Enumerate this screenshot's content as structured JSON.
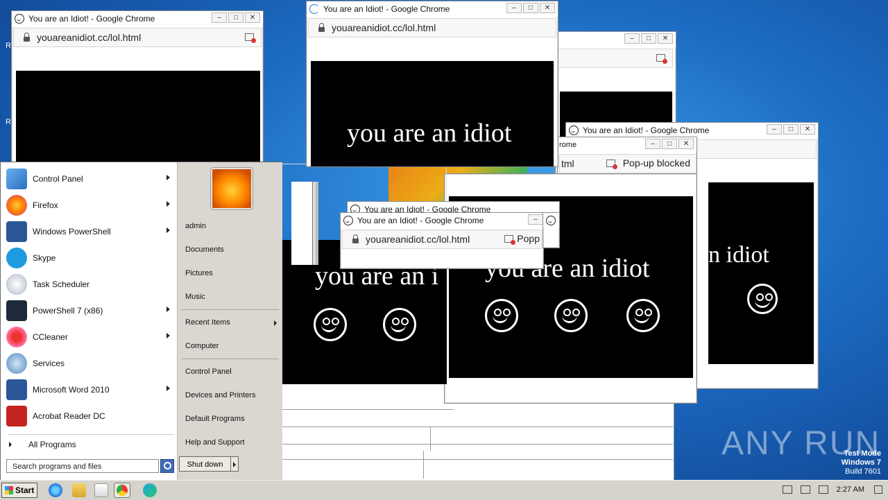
{
  "popup": {
    "title": "You are an Idiot! - Google Chrome",
    "url": "youareanidiot.cc/lol.html",
    "message": "you are an idiot",
    "popup_blocked": "Pop-up blocked",
    "url_partial": "youareanidiot.cc/lol.html",
    "url_fragment": "tml",
    "title_fragment": "rome",
    "popup_partial": "Popp",
    "idiot_partial": "you are an i",
    "idiot_right": "n idiot"
  },
  "window_buttons": {
    "minimize": "–",
    "maximize": "□",
    "close": "✕"
  },
  "start_menu": {
    "left_items": [
      {
        "label": "Control Panel",
        "icon": "control-panel-icon",
        "submenu": true
      },
      {
        "label": "Firefox",
        "icon": "firefox-icon",
        "submenu": true
      },
      {
        "label": "Windows PowerShell",
        "icon": "powershell-icon",
        "submenu": true
      },
      {
        "label": "Skype",
        "icon": "skype-icon",
        "submenu": false
      },
      {
        "label": "Task Scheduler",
        "icon": "task-scheduler-icon",
        "submenu": false
      },
      {
        "label": "PowerShell 7 (x86)",
        "icon": "powershell7-icon",
        "submenu": true
      },
      {
        "label": "CCleaner",
        "icon": "ccleaner-icon",
        "submenu": true
      },
      {
        "label": "Services",
        "icon": "services-icon",
        "submenu": false
      },
      {
        "label": "Microsoft Word 2010",
        "icon": "word-icon",
        "submenu": true
      },
      {
        "label": "Acrobat Reader DC",
        "icon": "acrobat-icon",
        "submenu": false
      }
    ],
    "all_programs": "All Programs",
    "search_placeholder": "Search programs and files",
    "right_items": {
      "user": "admin",
      "documents": "Documents",
      "pictures": "Pictures",
      "music": "Music",
      "recent": "Recent Items",
      "computer": "Computer",
      "control_panel": "Control Panel",
      "devices": "Devices and Printers",
      "default_programs": "Default Programs",
      "help": "Help and Support"
    },
    "shutdown": "Shut down"
  },
  "taskbar": {
    "start_label": "Start",
    "time": "2:27 AM",
    "pinned": [
      "ie-icon",
      "explorer-icon",
      "media-player-icon",
      "chrome-icon",
      "edge-icon"
    ]
  },
  "watermark": {
    "line1": "Test Mode",
    "line2": "Windows 7",
    "line3": "Build 7601",
    "brand": "ANY RUN"
  },
  "colors": {
    "desktop": "#1c6cc4",
    "popup_bg": "#000000",
    "text_white": "#ffffff"
  }
}
